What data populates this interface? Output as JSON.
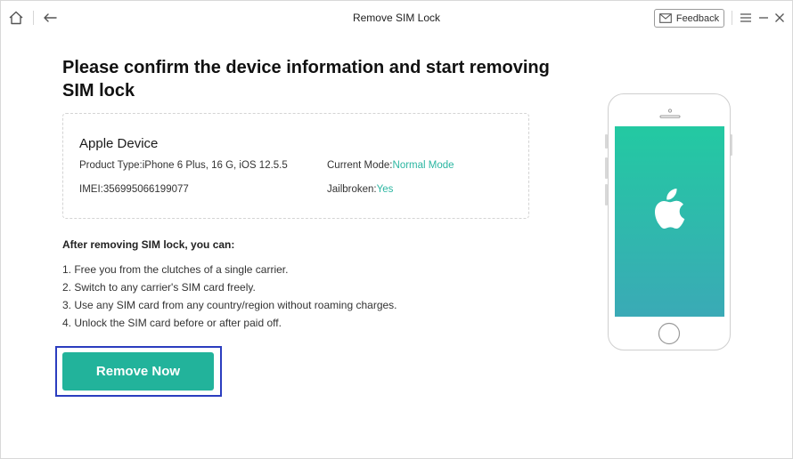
{
  "titlebar": {
    "title": "Remove SIM Lock",
    "feedback_label": "Feedback",
    "icons": [
      "home-icon",
      "back-arrow-icon",
      "mail-icon",
      "menu-icon",
      "minimize-icon",
      "close-icon"
    ]
  },
  "main": {
    "heading": "Please confirm the device information and start removing SIM lock",
    "device": {
      "title": "Apple Device",
      "product_type_label": "Product Type:",
      "product_type_value": "iPhone 6 Plus, 16 G, iOS 12.5.5",
      "current_mode_label": "Current Mode:",
      "current_mode_value": "Normal Mode",
      "imei_label": "IMEI:",
      "imei_value": "356995066199077",
      "jailbroken_label": "Jailbroken:",
      "jailbroken_value": "Yes"
    },
    "after_title": "After removing SIM lock, you can:",
    "benefits": [
      "1. Free you from the clutches of a single carrier.",
      "2. Switch to any carrier's SIM card freely.",
      "3. Use any SIM card from any country/region without roaming charges.",
      "4. Unlock the SIM card before or after paid off."
    ],
    "remove_button_label": "Remove Now"
  },
  "colors": {
    "accent": "#22b39b",
    "green_text": "#2bb6a1",
    "focus_ring": "#2b3dbf",
    "phone_screen_top": "#23c9a2",
    "phone_screen_bottom": "#3aaab6"
  }
}
